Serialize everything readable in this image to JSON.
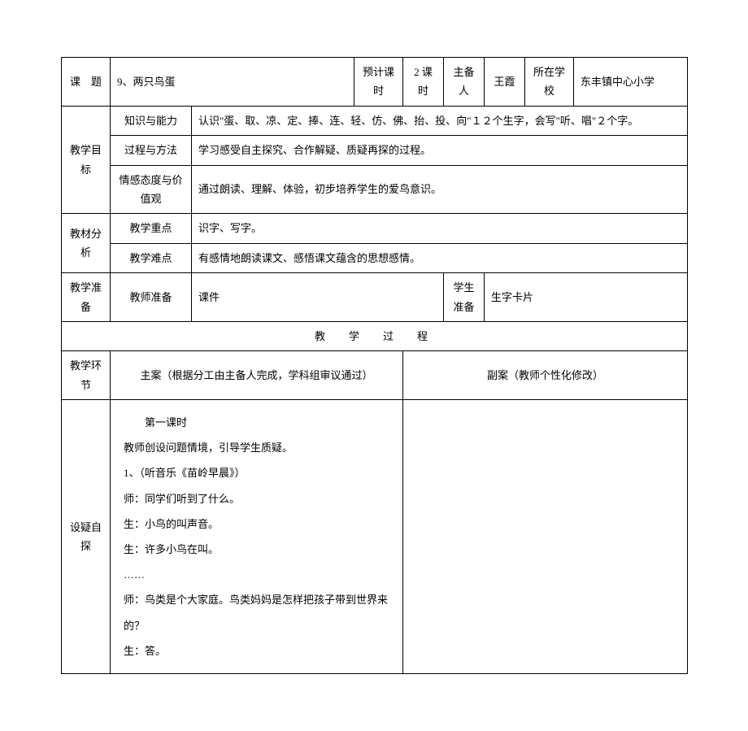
{
  "header": {
    "topic_label": "课　题",
    "topic_value": "9、两只鸟蛋",
    "planned_hours_label": "预计课时",
    "planned_hours_value": "2 课时",
    "preparer_label": "主备人",
    "preparer_value": "王霞",
    "school_label": "所在学校",
    "school_value": "东丰镇中心小学"
  },
  "objectives": {
    "label": "教学目标",
    "rows": [
      {
        "sub": "知识与能力",
        "text": "认识\"蛋、取、凉、定、捧、连、轻、仿、佛、抬、投、向\"１２个生字，会写\"听、唱\"２个字。"
      },
      {
        "sub": "过程与方法",
        "text": "学习感受自主探究、合作解疑、质疑再探的过程。"
      },
      {
        "sub": "情感态度与价值观",
        "text": "通过朗读、理解、体验，初步培养学生的爱鸟意识。"
      }
    ]
  },
  "analysis": {
    "label": "教材分析",
    "rows": [
      {
        "sub": "教学重点",
        "text": "识字、写字。"
      },
      {
        "sub": "教学难点",
        "text": "有感情地朗读课文、感悟课文蕴含的思想感情。"
      }
    ]
  },
  "prep": {
    "label": "教学准备",
    "teacher_label": "教师准备",
    "teacher_value": "课件",
    "student_label": "学生准备",
    "student_value": "生字卡片"
  },
  "process": {
    "title": "教　学　过　程",
    "stage_label": "教学环节",
    "main_label": "主案（根据分工由主备人完成，学科组审议通过）",
    "side_label": "副案（教师个性化修改）"
  },
  "stage1": {
    "name": "设疑自探",
    "lines": [
      "第一课时",
      "教师创设问题情境，引导学生质疑。",
      "1、（听音乐《苗岭早晨》）",
      "师：同学们听到了什么。",
      "生：小鸟的叫声音。",
      "生：许多小鸟在叫。",
      "……",
      "师：鸟类是个大家庭。鸟类妈妈是怎样把孩子带到世界来的？",
      "生：答。"
    ]
  }
}
